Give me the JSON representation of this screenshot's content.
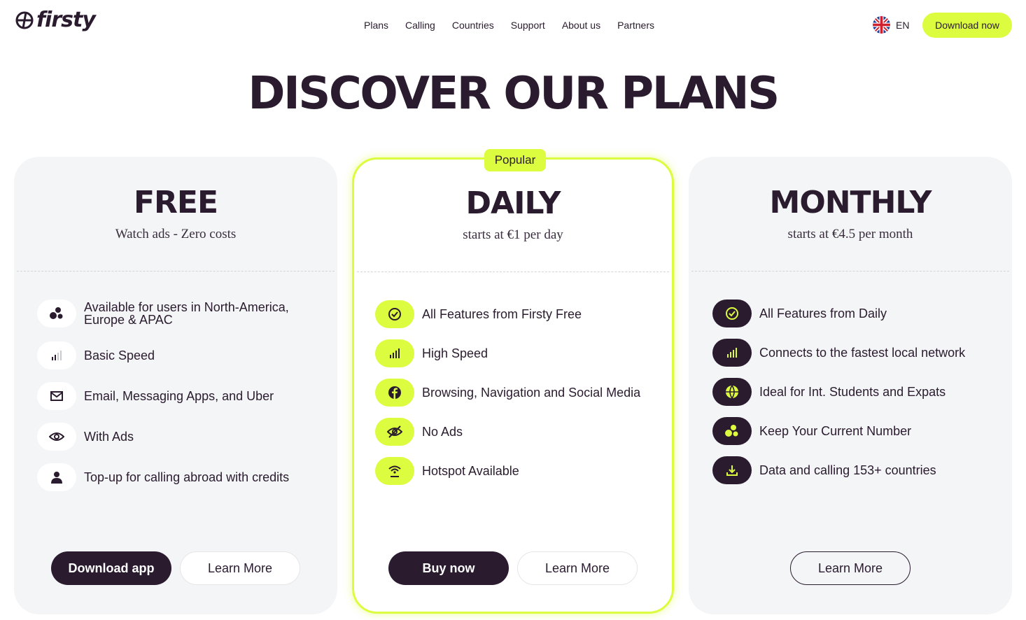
{
  "header": {
    "logo_text": "firsty",
    "nav": [
      "Plans",
      "Calling",
      "Countries",
      "Support",
      "About us",
      "Partners"
    ],
    "language": "EN",
    "cta": "Download now"
  },
  "title": "DISCOVER OUR PLANS",
  "plans": {
    "free": {
      "name": "FREE",
      "subtitle": "Watch ads - Zero costs",
      "features": [
        {
          "text": "Available for users in North-America, Europe & APAC",
          "icon": "dots-cluster-icon"
        },
        {
          "text": "Basic Speed",
          "icon": "signal-bars-icon"
        },
        {
          "text": "Email, Messaging Apps, and Uber",
          "icon": "mail-icon"
        },
        {
          "text": "With Ads",
          "icon": "eye-icon"
        },
        {
          "text": "Top-up for calling abroad with credits",
          "icon": "user-icon"
        }
      ],
      "primary_button": "Download app",
      "secondary_button": "Learn More"
    },
    "daily": {
      "badge": "Popular",
      "name": "DAILY",
      "subtitle": "starts at €1 per day",
      "features": [
        {
          "text": "All Features from Firsty Free",
          "icon": "check-circle-icon"
        },
        {
          "text": "High Speed",
          "icon": "signal-bars-icon"
        },
        {
          "text": "Browsing, Navigation and Social Media",
          "icon": "facebook-icon"
        },
        {
          "text": "No Ads",
          "icon": "eye-off-icon"
        },
        {
          "text": "Hotspot Available",
          "icon": "hotspot-icon"
        }
      ],
      "primary_button": "Buy now",
      "secondary_button": "Learn More"
    },
    "monthly": {
      "name": "MONTHLY",
      "subtitle": "starts at €4.5 per month",
      "features": [
        {
          "text": "All Features from Daily",
          "icon": "check-circle-icon"
        },
        {
          "text": "Connects to the fastest local network",
          "icon": "signal-bars-icon"
        },
        {
          "text": "Ideal for Int. Students and Expats",
          "icon": "globe-icon"
        },
        {
          "text": "Keep Your Current Number",
          "icon": "dots-cluster-icon"
        },
        {
          "text": "Data and calling 153+ countries",
          "icon": "download-icon"
        }
      ],
      "secondary_button": "Learn More"
    }
  },
  "colors": {
    "accent": "#dcfc3f",
    "dark": "#2a1b2e",
    "card_bg": "#f3f5f7"
  }
}
